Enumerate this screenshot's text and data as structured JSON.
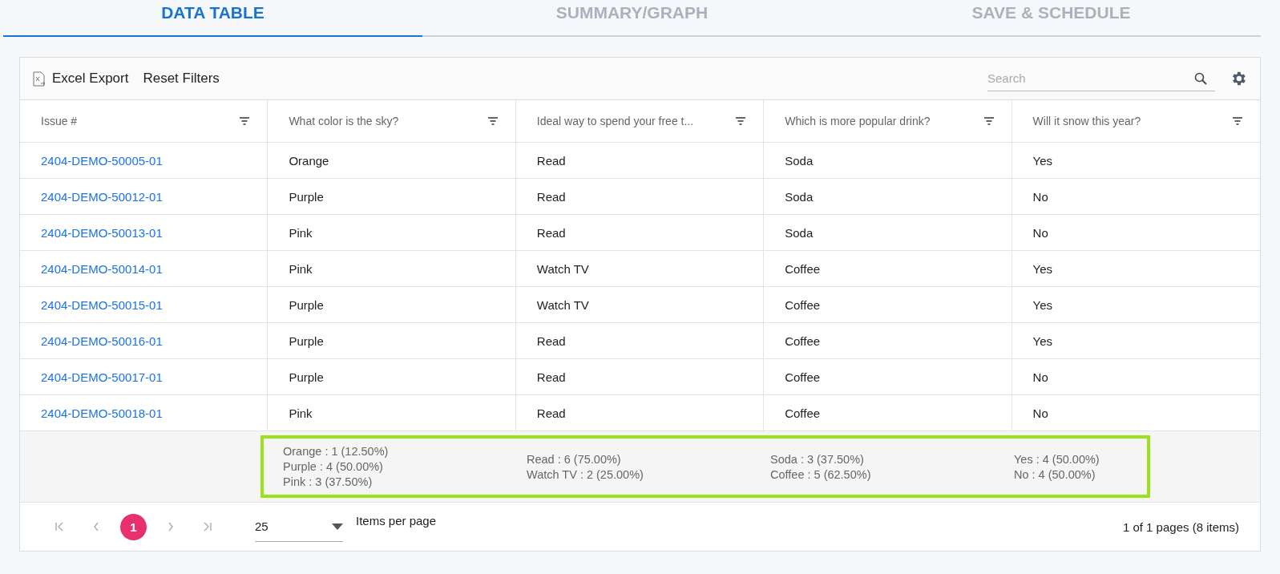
{
  "tabs": [
    {
      "label": "DATA TABLE",
      "selected": true
    },
    {
      "label": "SUMMARY/GRAPH",
      "selected": false
    },
    {
      "label": "SAVE & SCHEDULE",
      "selected": false
    }
  ],
  "toolbar": {
    "buttons": [
      "Excel Export",
      "Reset Filters"
    ],
    "search": {
      "placeholder": "Search"
    }
  },
  "table": {
    "columns": [
      "Issue #",
      "What color is the sky?",
      "Ideal way to spend your free t...",
      "Which is more popular drink?",
      "Will it snow this year?"
    ],
    "rows": [
      [
        "2404-DEMO-50005-01",
        "Orange",
        "Read",
        "Soda",
        "Yes"
      ],
      [
        "2404-DEMO-50012-01",
        "Purple",
        "Read",
        "Soda",
        "No"
      ],
      [
        "2404-DEMO-50013-01",
        "Pink",
        "Read",
        "Soda",
        "No"
      ],
      [
        "2404-DEMO-50014-01",
        "Pink",
        "Watch TV",
        "Coffee",
        "Yes"
      ],
      [
        "2404-DEMO-50015-01",
        "Purple",
        "Watch TV",
        "Coffee",
        "Yes"
      ],
      [
        "2404-DEMO-50016-01",
        "Purple",
        "Read",
        "Coffee",
        "Yes"
      ],
      [
        "2404-DEMO-50017-01",
        "Purple",
        "Read",
        "Coffee",
        "No"
      ],
      [
        "2404-DEMO-50018-01",
        "Pink",
        "Read",
        "Coffee",
        "No"
      ]
    ],
    "summary": {
      "highlighted": true,
      "columns": [
        [
          "Orange : 1 (12.50%)",
          "Purple : 4 (50.00%)",
          "Pink : 3 (37.50%)"
        ],
        [
          "Read : 6 (75.00%)",
          "Watch TV : 2 (25.00%)"
        ],
        [
          "Soda : 3 (37.50%)",
          "Coffee : 5 (62.50%)"
        ],
        [
          "Yes : 4 (50.00%)",
          "No : 4 (50.00%)"
        ]
      ]
    }
  },
  "pager": {
    "pages": [
      {
        "label": "1",
        "selected": true
      }
    ],
    "page_size": "25",
    "page_size_label": "Items per page",
    "info": "1 of 1 pages (8 items)"
  }
}
